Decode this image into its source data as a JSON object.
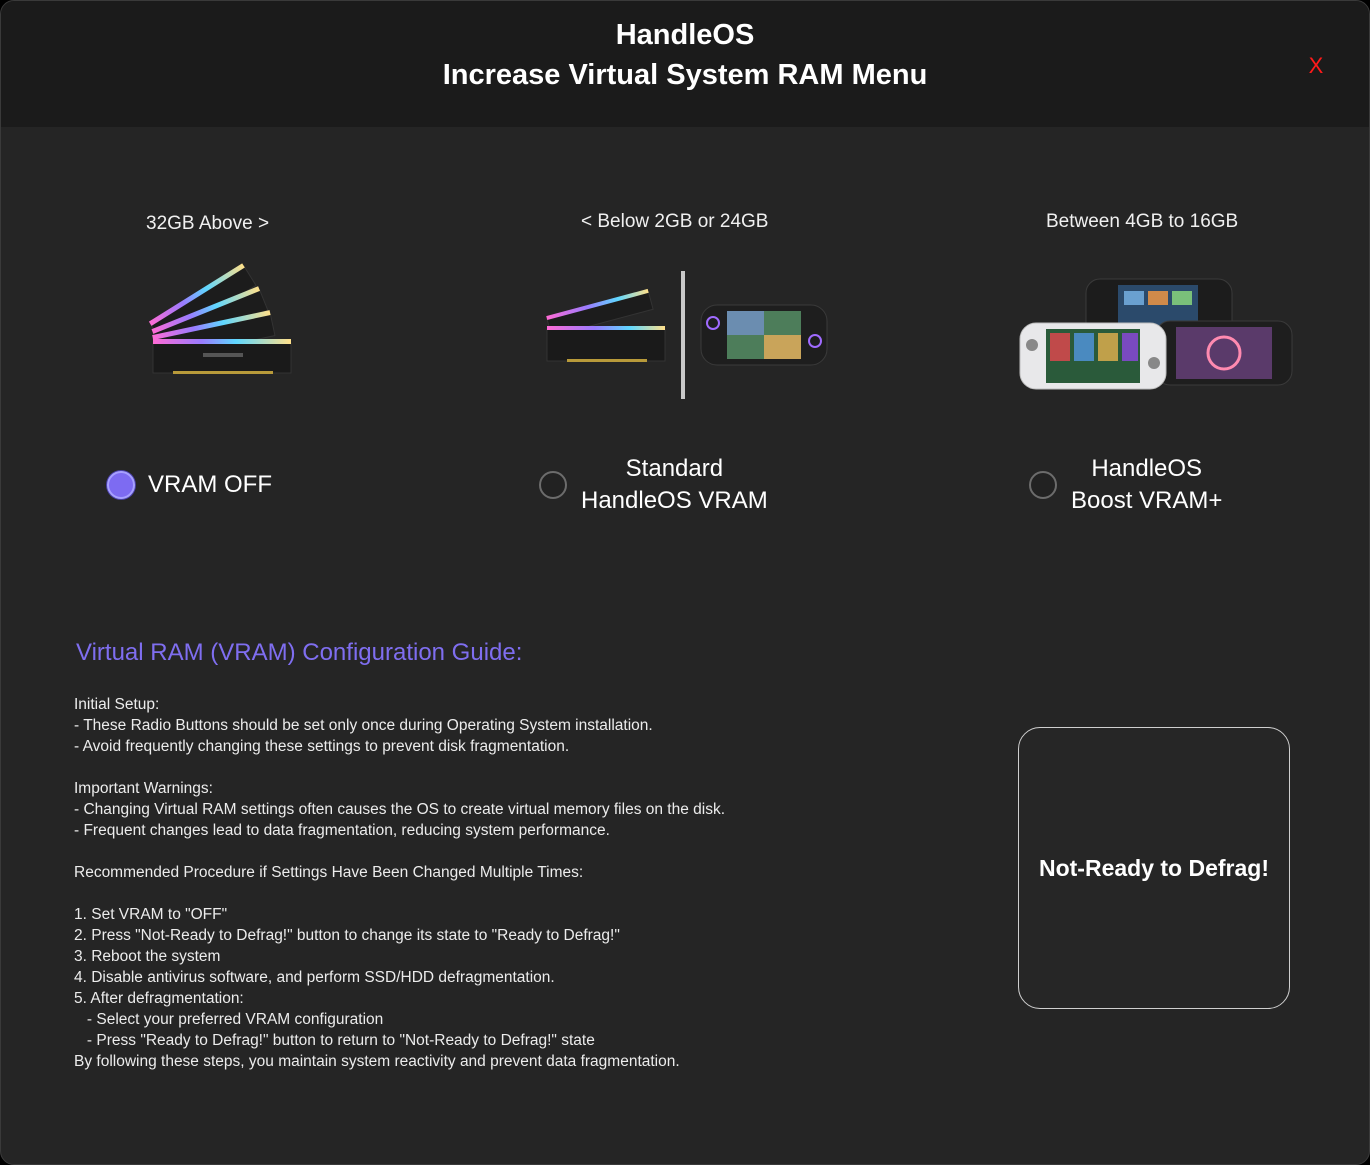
{
  "window": {
    "title_line1": "HandleOS",
    "title_line2": "Increase Virtual System RAM Menu",
    "close_label": "X",
    "close_color": "#ff1a1a"
  },
  "options": [
    {
      "caption": "32GB Above >",
      "illustration": "rgb-ram-sticks",
      "label_line1": "VRAM OFF",
      "label_line2": "",
      "selected": true
    },
    {
      "caption": "< Below 2GB or 24GB",
      "illustration": "ram-stick-and-handheld",
      "label_line1": "Standard",
      "label_line2": "HandleOS VRAM",
      "selected": false
    },
    {
      "caption": "Between 4GB to 16GB",
      "illustration": "handheld-consoles",
      "label_line1": "HandleOS",
      "label_line2": "Boost VRAM+",
      "selected": false
    }
  ],
  "guide": {
    "title": "Virtual RAM (VRAM) Configuration Guide:",
    "body": "Initial Setup:\n- These Radio Buttons should be set only once during Operating System installation.\n- Avoid frequently changing these settings to prevent disk fragmentation.\n\nImportant Warnings:\n- Changing Virtual RAM settings often causes the OS to create virtual memory files on the disk.\n- Frequent changes lead to data fragmentation, reducing system performance.\n\nRecommended Procedure if Settings Have Been Changed Multiple Times:\n\n1. Set VRAM to \"OFF\"\n2. Press \"Not-Ready to Defrag!\" button to change its state to \"Ready to Defrag!\"\n3. Reboot the system\n4. Disable antivirus software, and perform SSD/HDD defragmentation.\n5. After defragmentation:\n   - Select your preferred VRAM configuration\n   - Press \"Ready to Defrag!\" button to return to \"Not-Ready to Defrag!\" state\nBy following these steps, you maintain system reactivity and prevent data fragmentation."
  },
  "defrag_button": {
    "label": "Not-Ready to Defrag!"
  },
  "colors": {
    "accent": "#7d6bf2",
    "guide_title": "#7f6ef0",
    "background": "#252525",
    "titlebar": "#1b1b1b"
  }
}
